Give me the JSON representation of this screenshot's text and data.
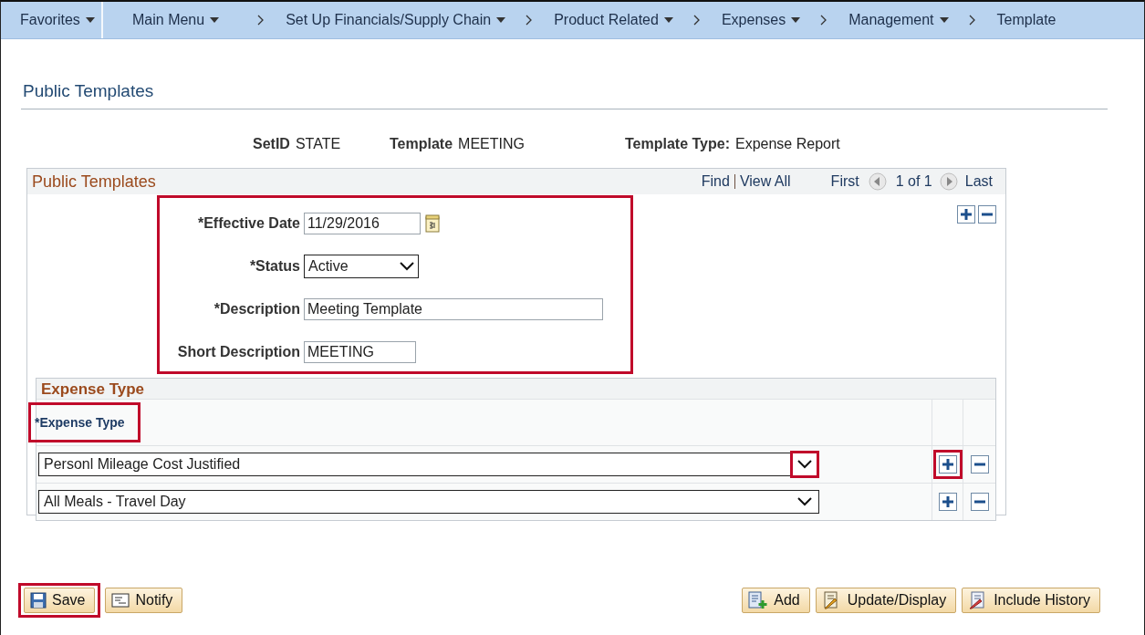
{
  "nav": {
    "items": [
      {
        "label": "Favorites",
        "menu": true
      },
      {
        "label": "Main Menu",
        "menu": true
      },
      {
        "label": "Set Up Financials/Supply Chain",
        "menu": true
      },
      {
        "label": "Product Related",
        "menu": true
      },
      {
        "label": "Expenses",
        "menu": true
      },
      {
        "label": "Management",
        "menu": true
      },
      {
        "label": "Template",
        "menu": false
      }
    ]
  },
  "page_title": "Public Templates",
  "keys": [
    {
      "label": "SetID",
      "value": "STATE"
    },
    {
      "label": "Template",
      "value": "MEETING"
    },
    {
      "label": "Template Type:",
      "value": "Expense Report"
    }
  ],
  "section": {
    "title": "Public Templates",
    "find": "Find",
    "view_all": "View All",
    "first": "First",
    "count": "1 of 1",
    "last": "Last"
  },
  "form": {
    "highlighted": true,
    "fields": [
      {
        "kind": "date",
        "label": "*Effective Date",
        "value": "11/29/2016"
      },
      {
        "kind": "select",
        "label": "*Status",
        "value": "Active"
      },
      {
        "kind": "text",
        "label": "*Description",
        "value": "Meeting Template"
      },
      {
        "kind": "short",
        "label": "Short Description",
        "value": "MEETING"
      }
    ]
  },
  "expense_grid": {
    "title": "Expense Type",
    "column": {
      "label": "*Expense Type",
      "highlighted": true
    },
    "rows": [
      {
        "value": "Personl Mileage Cost Justified",
        "arrow_highlighted": true,
        "add_highlighted": true
      },
      {
        "value": "All Meals - Travel Day",
        "arrow_highlighted": false,
        "add_highlighted": false
      }
    ]
  },
  "buttons_left": [
    {
      "label": "Save",
      "highlighted": true
    },
    {
      "label": "Notify",
      "highlighted": false
    }
  ],
  "buttons_right": [
    {
      "label": "Add",
      "highlighted": false
    },
    {
      "label": "Update/Display",
      "highlighted": false
    },
    {
      "label": "Include History",
      "highlighted": false
    }
  ]
}
